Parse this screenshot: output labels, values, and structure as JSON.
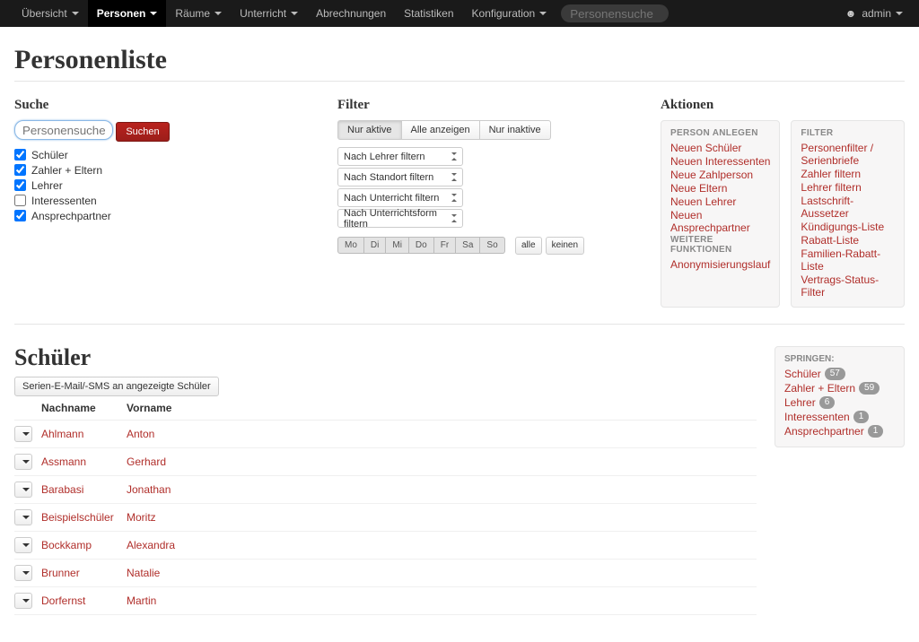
{
  "nav": {
    "items": [
      {
        "label": "Übersicht",
        "caret": true,
        "active": false
      },
      {
        "label": "Personen",
        "caret": true,
        "active": true
      },
      {
        "label": "Räume",
        "caret": true,
        "active": false
      },
      {
        "label": "Unterricht",
        "caret": true,
        "active": false
      },
      {
        "label": "Abrechnungen",
        "caret": false,
        "active": false
      },
      {
        "label": "Statistiken",
        "caret": false,
        "active": false
      },
      {
        "label": "Konfiguration",
        "caret": true,
        "active": false
      }
    ],
    "search_placeholder": "Personensuche",
    "user": "admin"
  },
  "page_title": "Personenliste",
  "suche": {
    "heading": "Suche",
    "placeholder": "Personensuche",
    "button": "Suchen",
    "checks": [
      {
        "label": "Schüler",
        "checked": true
      },
      {
        "label": "Zahler + Eltern",
        "checked": true
      },
      {
        "label": "Lehrer",
        "checked": true
      },
      {
        "label": "Interessenten",
        "checked": false
      },
      {
        "label": "Ansprechpartner",
        "checked": true
      }
    ]
  },
  "filter": {
    "heading": "Filter",
    "segs": [
      {
        "label": "Nur aktive",
        "active": true
      },
      {
        "label": "Alle anzeigen",
        "active": false
      },
      {
        "label": "Nur inaktive",
        "active": false
      }
    ],
    "selects": [
      "Nach Lehrer filtern",
      "Nach Standort filtern",
      "Nach Unterricht filtern",
      "Nach Unterrichtsform filtern"
    ],
    "days": [
      "Mo",
      "Di",
      "Mi",
      "Do",
      "Fr",
      "Sa",
      "So"
    ],
    "day_all": "alle",
    "day_none": "keinen"
  },
  "aktionen": {
    "heading": "Aktionen",
    "left": {
      "h1": "PERSON ANLEGEN",
      "links1": [
        "Neuen Schüler",
        "Neuen Interessenten",
        "Neue Zahlperson",
        "Neue Eltern",
        "Neuen Lehrer",
        "Neuen Ansprechpartner"
      ],
      "h2": "WEITERE FUNKTIONEN",
      "links2": [
        "Anonymisierungslauf"
      ]
    },
    "right": {
      "h1": "FILTER",
      "links": [
        "Personenfilter / Serienbriefe",
        "Zahler filtern",
        "Lehrer filtern",
        "Lastschrift-Aussetzer",
        "Kündigungs-Liste",
        "Rabatt-Liste",
        "Familien-Rabatt-Liste",
        "Vertrags-Status-Filter"
      ]
    }
  },
  "schueler": {
    "heading": "Schüler",
    "bulk_button": "Serien-E-Mail/-SMS an angezeigte Schüler",
    "cols": {
      "nachname": "Nachname",
      "vorname": "Vorname"
    },
    "rows": [
      {
        "nachname": "Ahlmann",
        "vorname": "Anton"
      },
      {
        "nachname": "Assmann",
        "vorname": "Gerhard"
      },
      {
        "nachname": "Barabasi",
        "vorname": "Jonathan"
      },
      {
        "nachname": "Beispielschüler",
        "vorname": "Moritz"
      },
      {
        "nachname": "Bockkamp",
        "vorname": "Alexandra"
      },
      {
        "nachname": "Brunner",
        "vorname": "Natalie"
      },
      {
        "nachname": "Dorfernst",
        "vorname": "Martin"
      }
    ]
  },
  "springen": {
    "heading": "SPRINGEN:",
    "items": [
      {
        "label": "Schüler",
        "count": "57"
      },
      {
        "label": "Zahler + Eltern",
        "count": "59"
      },
      {
        "label": "Lehrer",
        "count": "6"
      },
      {
        "label": "Interessenten",
        "count": "1"
      },
      {
        "label": "Ansprechpartner",
        "count": "1"
      }
    ]
  }
}
